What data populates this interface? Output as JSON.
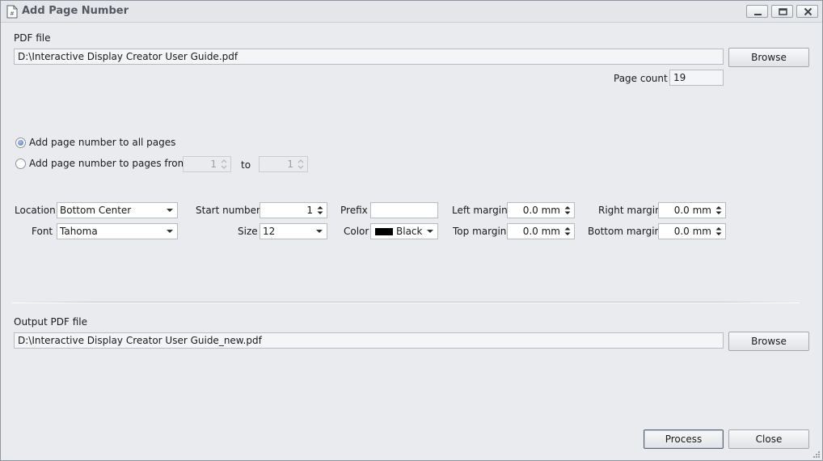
{
  "window": {
    "title": "Add Page Number",
    "controls": [
      "minimize-icon",
      "maximize-icon",
      "close-icon"
    ]
  },
  "pdf_file": {
    "label": "PDF file",
    "value": "D:\\Interactive Display Creator User Guide.pdf",
    "browse_label": "Browse"
  },
  "page_count": {
    "label": "Page count",
    "value": "19"
  },
  "range": {
    "all_pages_label": "Add page number to all pages",
    "range_label": "Add page number to pages from",
    "to_label": "to",
    "from_value": "1",
    "to_value": "1",
    "selected": "all"
  },
  "settings": {
    "location_label": "Location",
    "location_value": "Bottom Center",
    "font_label": "Font",
    "font_value": "Tahoma",
    "start_number_label": "Start number",
    "start_number_value": "1",
    "size_label": "Size",
    "size_value": "12",
    "prefix_label": "Prefix",
    "prefix_value": "",
    "color_label": "Color",
    "color_value": "Black",
    "color_hex": "#000000",
    "left_margin_label": "Left margin",
    "left_margin_value": "0.0 mm",
    "top_margin_label": "Top margin",
    "top_margin_value": "0.0 mm",
    "right_margin_label": "Right margin",
    "right_margin_value": "0.0 mm",
    "bottom_margin_label": "Bottom margin",
    "bottom_margin_value": "0.0 mm"
  },
  "output": {
    "label": "Output PDF file",
    "value": "D:\\Interactive Display Creator User Guide_new.pdf",
    "browse_label": "Browse"
  },
  "actions": {
    "process_label": "Process",
    "close_label": "Close"
  }
}
